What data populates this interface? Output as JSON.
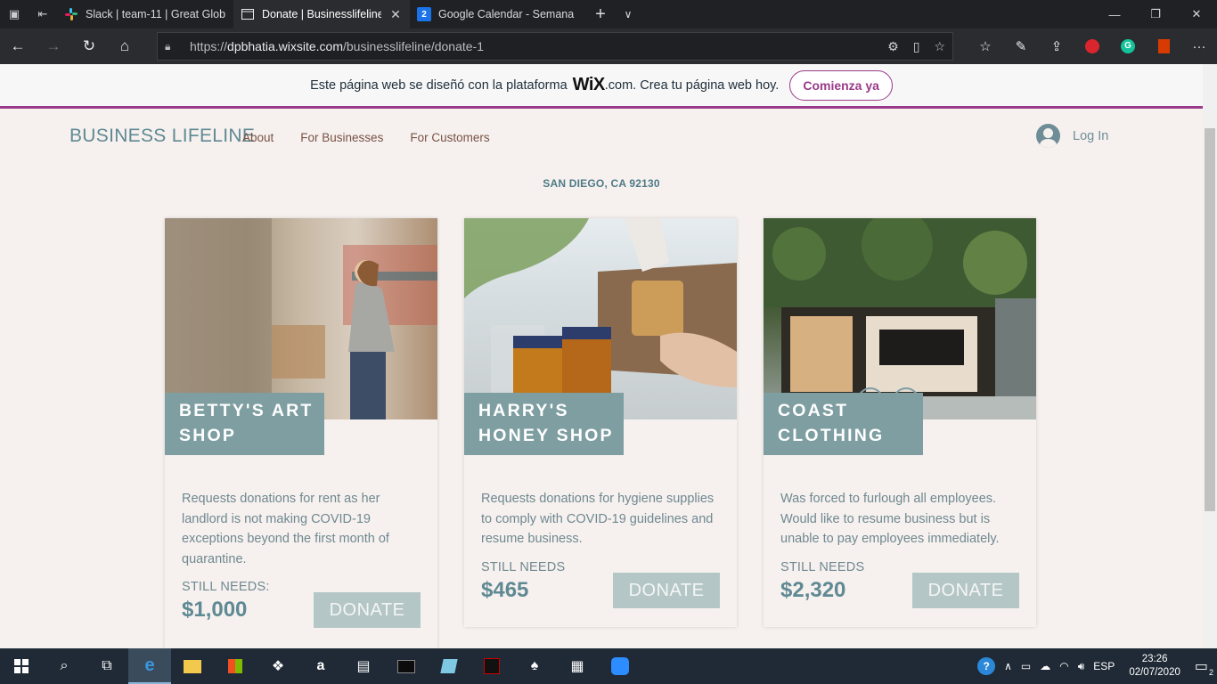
{
  "browser": {
    "tabs": [
      {
        "title": "Slack | team-11 | Great Glob"
      },
      {
        "title": "Donate | Businesslifeline"
      },
      {
        "title": "Google Calendar - Semana"
      }
    ],
    "calendar_badge": "2",
    "url_prefix": "https://",
    "url_host": "dpbhatia.wixsite.com",
    "url_path": "/businesslifeline/donate-1"
  },
  "wix_banner": {
    "text": "Este página web se diseñó con la plataforma",
    "logo": "WiX",
    "suffix": ".com. Crea tu página web hoy.",
    "cta": "Comienza ya"
  },
  "site": {
    "brand": "BUSINESS LIFELINE",
    "menu": [
      "About",
      "For Businesses",
      "For Customers"
    ],
    "login": "Log In",
    "location": "SAN DIEGO, CA 92130"
  },
  "cards": [
    {
      "name_line1": "BETTY'S ART",
      "name_line2": "SHOP",
      "desc": "Requests donations for rent as her landlord is not making COVID-19 exceptions beyond the first month of quarantine.",
      "still_needs": "STILL NEEDS:",
      "amount": "$1,000",
      "donate": "DONATE"
    },
    {
      "name_line1": "HARRY'S",
      "name_line2": "HONEY SHOP",
      "desc": "Requests donations for hygiene supplies to comply with COVID-19 guidelines and resume business.",
      "still_needs": "STILL NEEDS",
      "amount": "$465",
      "donate": "DONATE"
    },
    {
      "name_line1": "COAST",
      "name_line2": "CLOTHING",
      "desc": "Was forced to furlough all employees. Would like to resume business but is unable to pay employees immediately.",
      "still_needs": "STILL NEEDS",
      "amount": "$2,320",
      "donate": "DONATE"
    }
  ],
  "taskbar": {
    "lang": "ESP",
    "time": "23:26",
    "date": "02/07/2020",
    "notifications": "2"
  },
  "colors": {
    "accent": "#9a3a8a",
    "teal": "#5f8993",
    "tag": "#7e9ea1"
  }
}
